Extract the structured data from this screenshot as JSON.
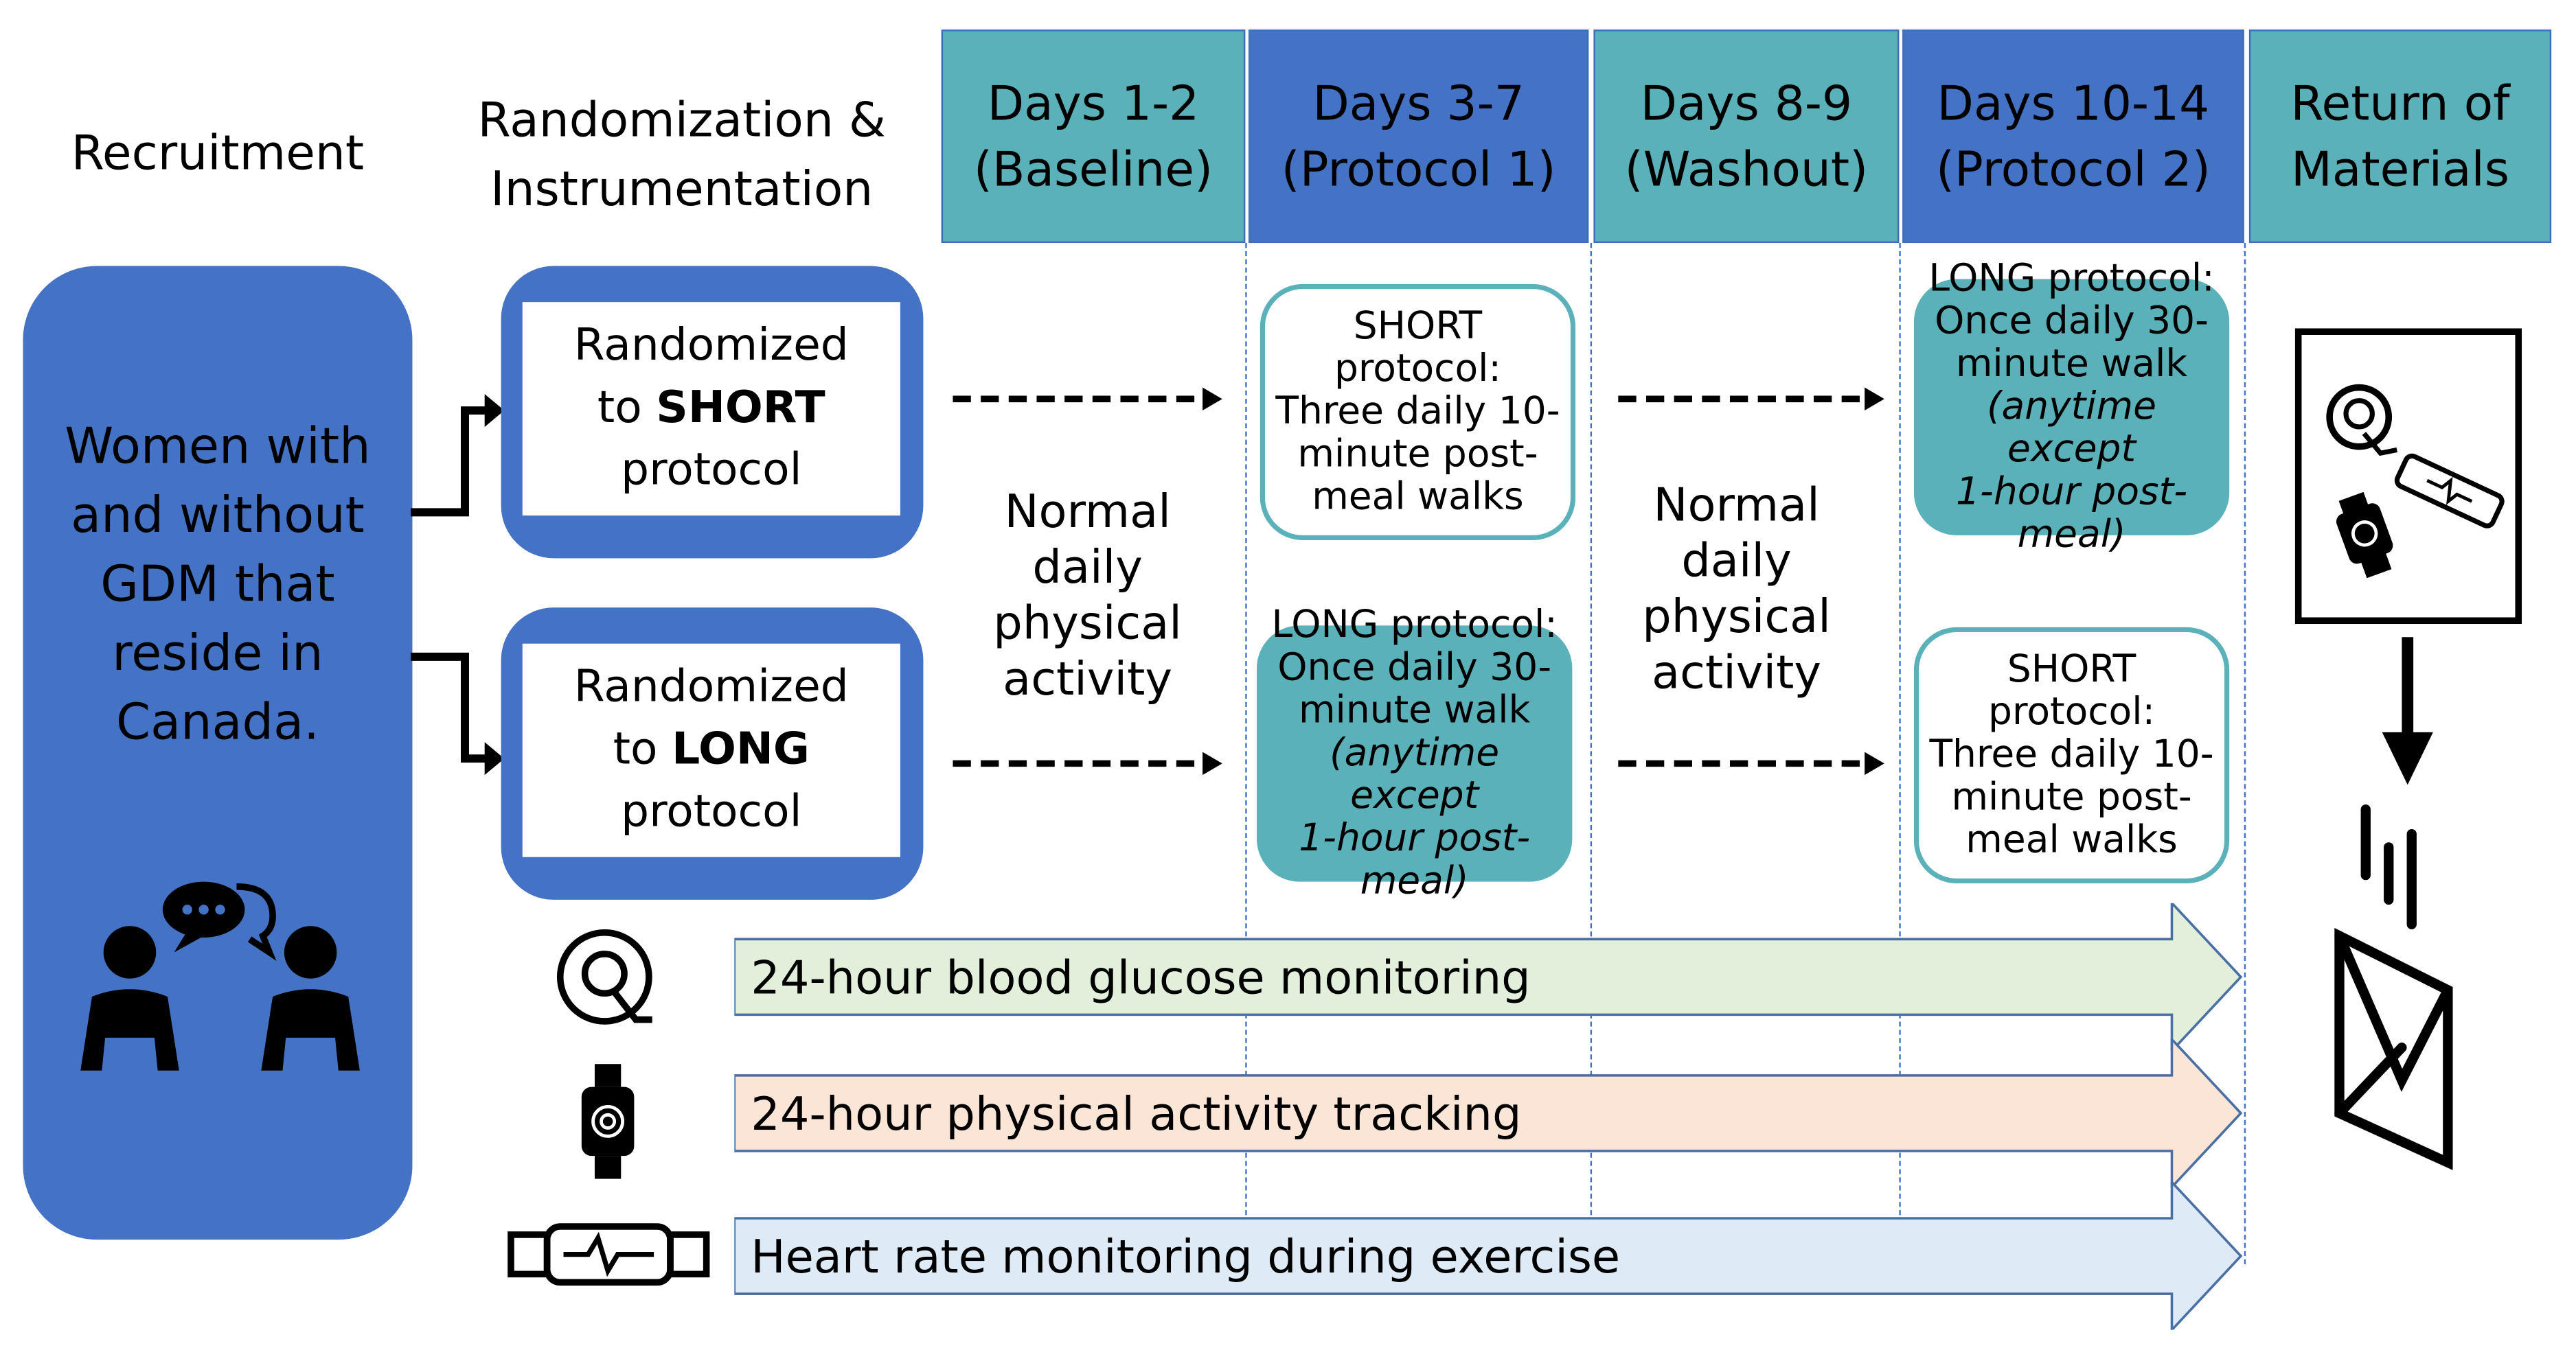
{
  "headers": {
    "recruitment": "Recruitment",
    "randomization": [
      "Randomization &",
      "Instrumentation"
    ],
    "phases": [
      {
        "line1": "Days 1-2",
        "line2": "(Baseline)",
        "color": "#5bb1b9"
      },
      {
        "line1": "Days 3-7",
        "line2": "(Protocol 1)",
        "color": "#4472c4"
      },
      {
        "line1": "Days 8-9",
        "line2": "(Washout)",
        "color": "#5bb1b9"
      },
      {
        "line1": "Days 10-14",
        "line2": "(Protocol 2)",
        "color": "#4472c4"
      },
      {
        "line1": "Return of",
        "line2": "Materials",
        "color": "#5bb1b9"
      }
    ]
  },
  "participants": {
    "text": [
      "Women with",
      "and without",
      "GDM that",
      "reside in",
      "Canada."
    ],
    "icon": "people-talking-icon"
  },
  "randomized": [
    {
      "l1": "Randomized",
      "l2a": "to ",
      "l2b": "SHORT",
      "l3": "protocol"
    },
    {
      "l1": "Randomized",
      "l2a": "to ",
      "l2b": "LONG",
      "l3": "protocol"
    }
  ],
  "normal_activity": [
    "Normal",
    "daily",
    "physical",
    "activity"
  ],
  "short_protocol": {
    "lines": [
      "SHORT",
      "protocol:",
      "Three daily 10-",
      "minute post-",
      "meal walks"
    ]
  },
  "long_protocol": {
    "lines": [
      "LONG protocol:",
      "Once daily 30-",
      "minute walk"
    ],
    "italic": [
      "(anytime except",
      "1-hour post-",
      "meal)"
    ]
  },
  "monitoring": [
    {
      "label": "24-hour blood glucose monitoring",
      "color": "#e2efda",
      "icon": "glucose-sensor-icon"
    },
    {
      "label": "24-hour physical activity tracking",
      "color": "#fbe5d6",
      "icon": "smartwatch-icon"
    },
    {
      "label": "Heart rate monitoring during exercise",
      "color": "#deebf7",
      "icon": "heart-rate-strap-icon"
    }
  ],
  "return_icons": [
    "devices-icon",
    "down-arrow-icon",
    "mail-envelope-icon"
  ],
  "colors": {
    "teal": "#5bb1b9",
    "blue": "#4472c4"
  }
}
